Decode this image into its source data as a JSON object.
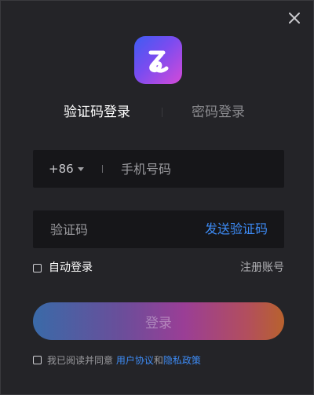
{
  "window": {
    "close_icon": "close-icon"
  },
  "logo": {
    "icon": "app-logo-icon",
    "colors": [
      "#3e5cf2",
      "#7a4cf0",
      "#d54ad8"
    ]
  },
  "tabs": [
    {
      "label": "验证码登录",
      "active": true
    },
    {
      "label": "密码登录",
      "active": false
    }
  ],
  "phone": {
    "country_code": "+86",
    "placeholder": "手机号码",
    "value": ""
  },
  "code": {
    "placeholder": "验证码",
    "value": "",
    "send_label": "发送验证码"
  },
  "options": {
    "auto_login_label": "自动登录",
    "auto_login_checked": false,
    "register_label": "注册账号"
  },
  "login": {
    "label": "登录"
  },
  "agreement": {
    "checked": false,
    "prefix": "我已阅读并同意 ",
    "user_agreement": "用户协议",
    "and": "和",
    "privacy_policy": "隐私政策"
  },
  "colors": {
    "accent": "#3d8bf5",
    "background": "#242428",
    "field_bg": "#161619"
  }
}
